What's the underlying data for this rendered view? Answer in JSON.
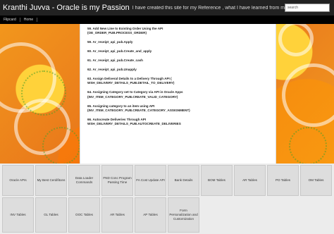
{
  "header": {
    "title": "Kranthi Juvva - Oracle is my Passion",
    "description": "I have created this site for my Reference , what I have learned from my...",
    "search_placeholder": "search"
  },
  "nav": {
    "items": [
      "Flipcard",
      "Home"
    ]
  },
  "post": {
    "items": [
      {
        "title": "59. Add New Line to Existing Order Using the API",
        "code": "(OE_ORDER_PUB.PROCESS_ORDER)"
      },
      {
        "title": "59. Ar_receipt_api_pub.Apply",
        "code": ""
      },
      {
        "title": "60. Ar_receipt_api_pub.Create_and_apply",
        "code": ""
      },
      {
        "title": "61. Ar_receipt_api_pub.Create_cash",
        "code": ""
      },
      {
        "title": "62. Ar_receipt_api_pub.Unapply",
        "code": ""
      },
      {
        "title": "63. Assign Deliveral Details to a Delivery Through API (",
        "code": "WSH_DELIVERY_DETAILS_PUB.DETAIL_TO_DELIVERY)"
      },
      {
        "title": "64. Assigning Category set to Category via API in Oracle Apps",
        "code": "(INV_ITEM_CATEGORY_PUB.CREATE_VALID_CATEGORY)"
      },
      {
        "title": "65. Assigning category to an item using API",
        "code": "(INV_ITEM_CATEGORY_PUB.CREATE_CATEGORY_ASSIGNMENT)"
      },
      {
        "title": "66. Autocreate Deliveries Through API",
        "code": "WSH_DELIVERY_DETAILS_PUB.AUTOCREATE_DELIVERIES"
      }
    ]
  },
  "tiles": [
    "Oracle APIs",
    "My Best Cerdifitons",
    "Data Loader Commands",
    "FND Conc Program Passing Time",
    "FA Cost Update API",
    "Bank Details",
    "BOM Tables",
    "AR Tables",
    "PO Tables",
    "OM Tables",
    "INV Tables",
    "GL Tables",
    "OOC Tables",
    "AR Tables",
    "AP Tables",
    "Form Personalization and Customization",
    "",
    "",
    "",
    ""
  ]
}
